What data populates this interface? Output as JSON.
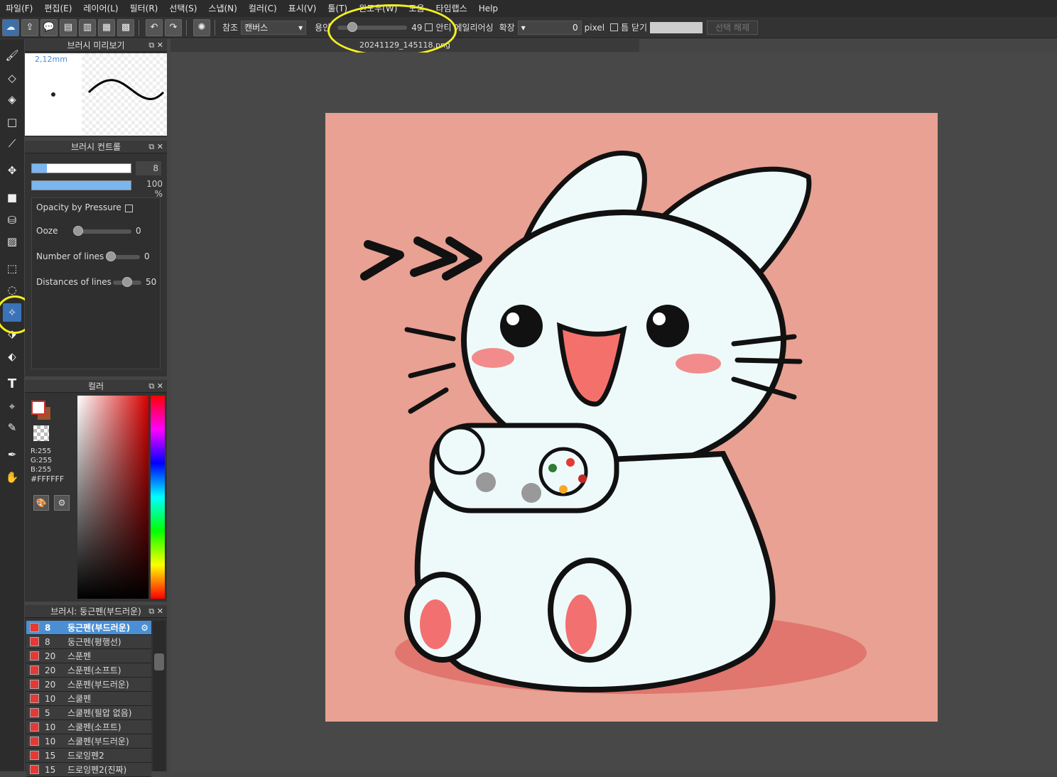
{
  "menu": [
    "파일(F)",
    "편집(E)",
    "레이어(L)",
    "필터(R)",
    "선택(S)",
    "스냅(N)",
    "컬러(C)",
    "표시(V)",
    "툴(T)",
    "윈도우(W)",
    "도움",
    "타임랩스",
    "Help"
  ],
  "toolbar": {
    "reference_label": "참조",
    "reference_value": "캔버스",
    "tolerance_label": "용인",
    "tolerance_value": "49",
    "tolerance_fraction": 0.14,
    "antialias_label": "안티 에일리어싱",
    "expand_label": "확장",
    "expand_value": "0",
    "expand_unit": "pixel",
    "close_gap_label": "틈 닫기",
    "deselect_label": "선택 해제"
  },
  "document_tab": "20241129_145118.png",
  "brush_preview": {
    "title": "브러시 미리보기",
    "size_label": "2,12mm"
  },
  "brush_control": {
    "title": "브러시 컨트롤",
    "size_value": "8",
    "size_fraction": 0.15,
    "opacity_value": "100 %",
    "opacity_fraction": 1.0,
    "opacity_by_pressure": "Opacity by Pressure",
    "ooze_label": "Ooze",
    "ooze_value": "0",
    "lines_label": "Number of lines",
    "lines_value": "0",
    "dist_label": "Distances of lines",
    "dist_value": "50"
  },
  "color_panel": {
    "title": "컬러",
    "r": "R:255",
    "g": "G:255",
    "b": "B:255",
    "hex": "#FFFFFF"
  },
  "brush_list": {
    "title": "브러시: 둥근펜(부드러운)",
    "items": [
      {
        "size": "8",
        "name": "둥근펜(부드러운)",
        "selected": true
      },
      {
        "size": "8",
        "name": "둥근펜(평행선)"
      },
      {
        "size": "20",
        "name": "스푼펜"
      },
      {
        "size": "20",
        "name": "스푼펜(소프트)"
      },
      {
        "size": "20",
        "name": "스푼펜(부드러운)"
      },
      {
        "size": "10",
        "name": "스쿨펜"
      },
      {
        "size": "5",
        "name": "스쿨펜(필압 없음)"
      },
      {
        "size": "10",
        "name": "스쿨펜(소프트)"
      },
      {
        "size": "10",
        "name": "스쿨펜(부드러운)"
      },
      {
        "size": "15",
        "name": "드로잉펜2"
      },
      {
        "size": "15",
        "name": "드로잉펜2(진짜)"
      }
    ]
  },
  "canvas": {
    "background_color": "#e8a193"
  },
  "tools": [
    "brush-icon",
    "eraser-icon",
    "blur-eraser-icon",
    "shape-icon",
    "line-icon",
    "move-icon",
    "rect-fill-icon",
    "bucket-icon",
    "gradient-icon",
    "select-rect-icon",
    "lasso-icon",
    "magic-wand-icon",
    "select-pen-icon",
    "select-eraser-icon",
    "text-icon",
    "transform-icon",
    "dropper-pen-icon",
    "eyedropper-icon",
    "hand-icon"
  ]
}
